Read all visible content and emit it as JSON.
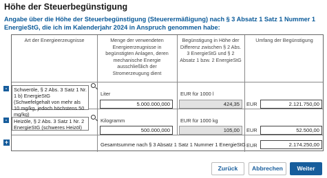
{
  "page": {
    "title": "Höhe der Steuerbegünstigung",
    "intro": "Angabe über die Höhe der Steuerbegünstigung (Steuerermäßigung) nach § 3 Absatz 1 Satz 1 Nummer 1 EnergieStG, die ich im Kalenderjahr 2024 in Anspruch genommen habe:"
  },
  "table": {
    "headers": [
      "Art der Energieerzeugnisse",
      "Menge der verwendeten Energieerzeugnisse in begünstigten Anlagen, deren mechanische Energie ausschließlich der Stromerzeugung dient",
      "Begünstigung in Höhe der Differenz zwischen § 2 Abs. 3 EnergieStG und § 2 Absatz 1 bzw. 2 EnergieStG",
      "Umfang der Begünstigung"
    ],
    "rows": [
      {
        "product": "Schweröle, § 2 Abs. 3 Satz 1 Nr. 1 b) EnergieStG (Schwefelgehalt von mehr als 10 mg/kg, jedoch höchstens 50 mg/kg)",
        "unit": "Liter",
        "amount": "5.000.000,000",
        "rate_label": "EUR für 1000 l",
        "rate": "424,35",
        "currency": "EUR",
        "value": "2.121.750,00"
      },
      {
        "product": "Heizöle, § 2 Abs. 3 Satz 1 Nr. 2 EnergieStG (schweres Heizöl)",
        "unit": "Kilogramm",
        "amount": "500.000,000",
        "rate_label": "EUR für 1000 kg",
        "rate": "105,00",
        "currency": "EUR",
        "value": "52.500,00"
      }
    ],
    "total_label": "Gesamtsumme nach § 3 Absatz 1 Satz 1 Nummer 1 EnergieStG",
    "total_currency": "EUR",
    "total_value": "2.174.250,00"
  },
  "buttons": {
    "back": "Zurück",
    "cancel": "Abbrechen",
    "next": "Weiter"
  },
  "colors": {
    "accent": "#175d9c",
    "intro_text": "#0a5a99",
    "readonly_bg": "#e2e2e2"
  },
  "icons": [
    "minus-icon",
    "plus-icon",
    "search-icon"
  ]
}
